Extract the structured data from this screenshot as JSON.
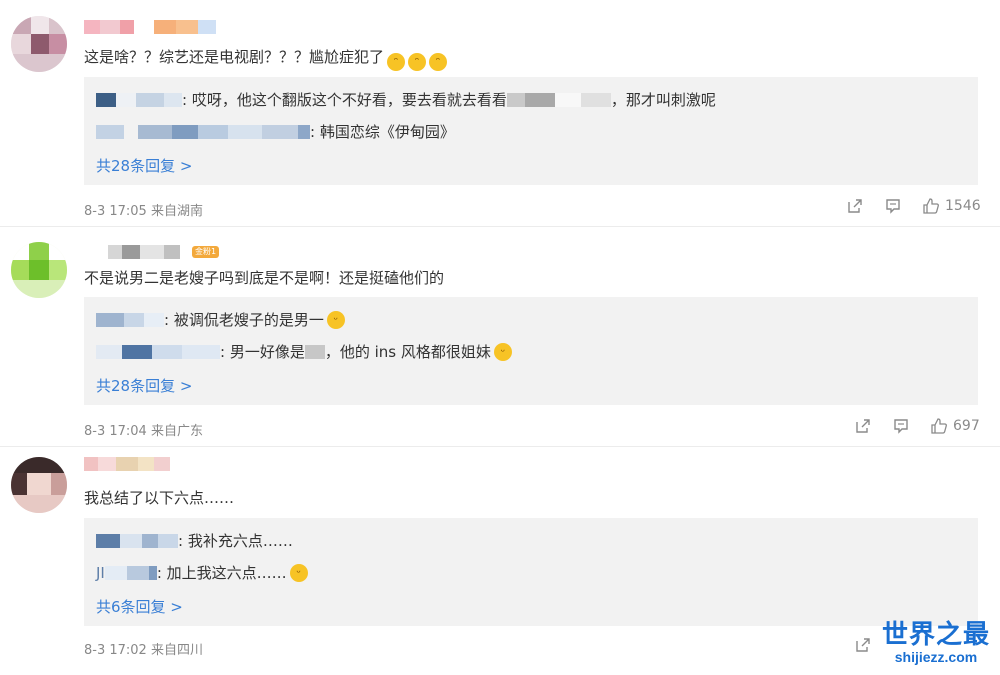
{
  "comments": [
    {
      "text": "这是啥？？综艺还是电视剧？？？尴尬症犯了",
      "replies": [
        {
          "suffix": ": 哎呀，他这个翻版这个不好看，要去看就去看看",
          "tail": "，那才叫刺激呢"
        },
        {
          "suffix": ": 韩国恋综《伊甸园》",
          "tail": ""
        }
      ],
      "more": "共28条回复 >",
      "meta": "8-3 17:05 来自湖南",
      "likes": "1546"
    },
    {
      "text": "不是说男二是老嫂子吗到底是不是啊！还是挺磕他们的",
      "badge": "金粉1",
      "replies": [
        {
          "suffix": ": 被调侃老嫂子的是男一",
          "tail": ""
        },
        {
          "suffix": ": 男一好像是",
          "tail": "，他的 ins 风格都很姐妹"
        }
      ],
      "more": "共28条回复 >",
      "meta": "8-3 17:04 来自广东",
      "likes": "697"
    },
    {
      "text": "我总结了以下六点……",
      "replies": [
        {
          "suffix": ": 我补充六点……",
          "tail": ""
        },
        {
          "prefix": "JI",
          "suffix": ": 加上我这六点……",
          "tail": ""
        }
      ],
      "more": "共6条回复 >",
      "meta": "8-3 17:02 来自四川",
      "likes": ""
    }
  ],
  "icons": {
    "share": "share-icon",
    "comment": "comment-icon",
    "like": "like-icon"
  },
  "watermark": {
    "title": "世界之最",
    "site": "shijiezz.com"
  },
  "colors": {
    "link": "#3a7fd5",
    "reply_bg": "#f2f2f2",
    "watermark": "#1a6fd1"
  }
}
